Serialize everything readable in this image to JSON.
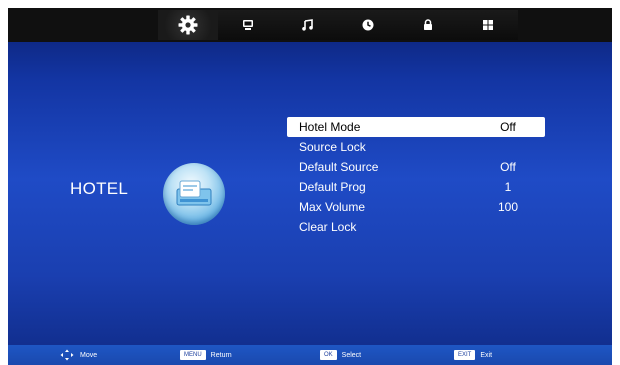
{
  "top_tabs": [
    {
      "icon": "gear-icon",
      "active": true
    },
    {
      "icon": "monitor-icon",
      "active": false
    },
    {
      "icon": "music-note-icon",
      "active": false
    },
    {
      "icon": "clock-icon",
      "active": false
    },
    {
      "icon": "lock-icon",
      "active": false
    },
    {
      "icon": "grid-icon",
      "active": false
    }
  ],
  "side": {
    "title": "HOTEL",
    "icon": "hotel-key-icon"
  },
  "menu": {
    "items": [
      {
        "label": "Hotel Mode",
        "value": "Off",
        "selected": true
      },
      {
        "label": "Source Lock",
        "value": ""
      },
      {
        "label": "Default Source",
        "value": "Off"
      },
      {
        "label": "Default Prog",
        "value": "1"
      },
      {
        "label": "Max Volume",
        "value": "100"
      },
      {
        "label": "Clear Lock",
        "value": ""
      }
    ]
  },
  "footer": {
    "move": {
      "icon": "move-arrows-icon",
      "label": "Move"
    },
    "return": {
      "key": "MENU",
      "label": "Return"
    },
    "select": {
      "key": "OK",
      "label": "Select"
    },
    "exit": {
      "key": "EXIT",
      "label": "Exit"
    }
  },
  "colors": {
    "accent_bg": "#1f4bc6",
    "selection": "#ffffff",
    "topbar": "#101010"
  }
}
